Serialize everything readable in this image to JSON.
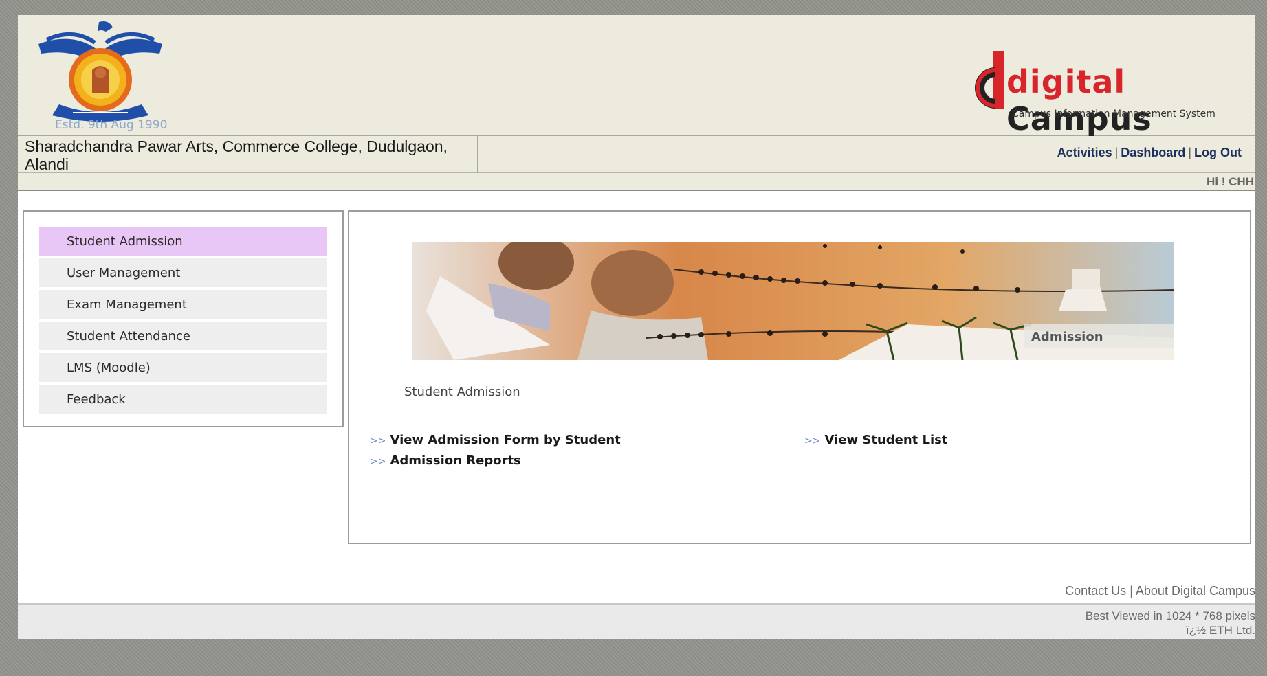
{
  "header": {
    "established": "Estd. 9th Aug 1990",
    "brand_word1": "digital",
    "brand_word2": "Campus",
    "brand_subtitle": "Campus Information Management System"
  },
  "college": {
    "name": "Sharadchandra Pawar Arts, Commerce College, Dudulgaon, Alandi"
  },
  "toplinks": {
    "activities": "Activities",
    "dashboard": "Dashboard",
    "logout": "Log Out",
    "separator": "|"
  },
  "greeting": "Hi ! CHH",
  "sidebar": {
    "items": [
      {
        "label": "Student Admission",
        "active": true
      },
      {
        "label": "User Management",
        "active": false
      },
      {
        "label": "Exam Management",
        "active": false
      },
      {
        "label": "Student Attendance",
        "active": false
      },
      {
        "label": "LMS (Moodle)",
        "active": false
      },
      {
        "label": "Feedback",
        "active": false
      }
    ]
  },
  "main": {
    "banner_label": "Admission",
    "section_title": "Student Admission",
    "arrow": ">>",
    "links": [
      {
        "label": "View Admission Form by Student"
      },
      {
        "label": "View Student List"
      },
      {
        "label": "Admission Reports"
      }
    ]
  },
  "footer": {
    "contact": "Contact Us",
    "about": "About Digital Campus",
    "separator": "|",
    "best_viewed": "Best Viewed in 1024 * 768 pixels",
    "copyright": "ï¿½ ETH Ltd."
  },
  "colors": {
    "header_bg": "#ecebde",
    "active_menu": "#e8c6f5",
    "brand_red": "#d8252b",
    "link_arrow": "#6b88c9"
  }
}
